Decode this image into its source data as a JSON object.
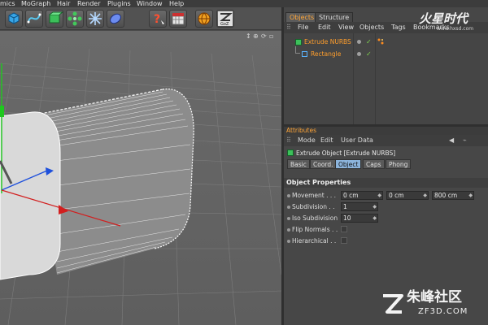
{
  "menubar": {
    "items": [
      {
        "id": "mi-0",
        "label": "mics"
      },
      {
        "id": "mi-1",
        "label": "MoGraph"
      },
      {
        "id": "mi-2",
        "label": "Hair"
      },
      {
        "id": "mi-3",
        "label": "Render"
      },
      {
        "id": "mi-4",
        "label": "Plugins"
      },
      {
        "id": "mi-5",
        "label": "Window"
      },
      {
        "id": "mi-6",
        "label": "Help"
      }
    ]
  },
  "toolbar": {
    "tools": [
      "cube-icon",
      "spline-icon",
      "nurbs-icon",
      "array-icon",
      "deformer-icon",
      "scene-icon",
      "help-icon",
      "render-icon",
      "globe-icon",
      "goz-icon"
    ],
    "goz_label": "GoZ"
  },
  "viewport": {
    "nav_icons": [
      "move-view-icon",
      "zoom-view-icon",
      "rotate-view-icon",
      "maximize-view-icon"
    ],
    "background_color": "#6e6e6e",
    "grid_color": "#7a7a7a",
    "object_color": "#d9d9d9"
  },
  "objects_panel": {
    "tabs": [
      {
        "id": "tab-objects",
        "label": "Objects",
        "active": true
      },
      {
        "id": "tab-structure",
        "label": "Structure",
        "active": false
      }
    ],
    "menu": [
      {
        "id": "om-file",
        "label": "File"
      },
      {
        "id": "om-edit",
        "label": "Edit"
      },
      {
        "id": "om-view",
        "label": "View"
      },
      {
        "id": "om-objects",
        "label": "Objects"
      },
      {
        "id": "om-tags",
        "label": "Tags"
      },
      {
        "id": "om-bookmarks",
        "label": "Bookmarks"
      }
    ],
    "items": [
      {
        "label": "Extrude NURBS",
        "check": "✓"
      },
      {
        "label": "Rectangle",
        "check": "✓"
      }
    ],
    "label_color": "#ff9e2c"
  },
  "attributes_panel": {
    "tab_label": "Attributes",
    "menu": [
      {
        "id": "am-mode",
        "label": "Mode"
      },
      {
        "id": "am-edit",
        "label": "Edit"
      },
      {
        "id": "am-userdata",
        "label": "User Data"
      }
    ],
    "title": "Extrude Object [Extrude NURBS]",
    "subtabs": [
      {
        "id": "st-basic",
        "label": "Basic"
      },
      {
        "id": "st-coord",
        "label": "Coord."
      },
      {
        "id": "st-object",
        "label": "Object"
      },
      {
        "id": "st-caps",
        "label": "Caps"
      },
      {
        "id": "st-phong",
        "label": "Phong"
      }
    ],
    "active_subtab": "Object",
    "section_header": "Object Properties",
    "properties": {
      "movement": {
        "label": "Movement . . .",
        "x": "0 cm",
        "y": "0 cm",
        "z": "800 cm"
      },
      "subdivision": {
        "label": "Subdivision . .",
        "value": "1"
      },
      "iso_subdivision": {
        "label": "Iso Subdivision",
        "value": "10"
      },
      "flip_normals": {
        "label": "Flip Normals . .",
        "checked": false
      },
      "hierarchical": {
        "label": "Hierarchical . .",
        "checked": false
      }
    }
  },
  "watermarks": {
    "top_main": "火星时代",
    "top_url": "www.hxsd.com",
    "bottom_cn": "朱峰社区",
    "bottom_en": "ZF3D.COM"
  },
  "colors": {
    "accent_orange": "#ffa537",
    "active_tab_blue": "#8cb4dc",
    "check_green": "#7fd34e",
    "axis_red": "#d21e1e",
    "axis_blue": "#1e50dc",
    "axis_green": "#1ec81e"
  }
}
